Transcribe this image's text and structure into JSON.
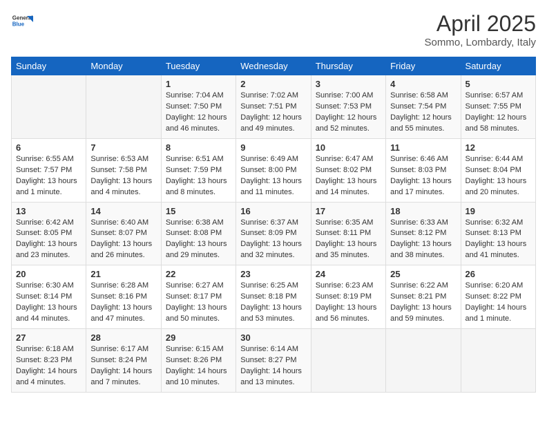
{
  "header": {
    "logo_general": "General",
    "logo_blue": "Blue",
    "month": "April 2025",
    "location": "Sommo, Lombardy, Italy"
  },
  "weekdays": [
    "Sunday",
    "Monday",
    "Tuesday",
    "Wednesday",
    "Thursday",
    "Friday",
    "Saturday"
  ],
  "weeks": [
    [
      null,
      null,
      {
        "day": "1",
        "info": "Sunrise: 7:04 AM\nSunset: 7:50 PM\nDaylight: 12 hours and 46 minutes."
      },
      {
        "day": "2",
        "info": "Sunrise: 7:02 AM\nSunset: 7:51 PM\nDaylight: 12 hours and 49 minutes."
      },
      {
        "day": "3",
        "info": "Sunrise: 7:00 AM\nSunset: 7:53 PM\nDaylight: 12 hours and 52 minutes."
      },
      {
        "day": "4",
        "info": "Sunrise: 6:58 AM\nSunset: 7:54 PM\nDaylight: 12 hours and 55 minutes."
      },
      {
        "day": "5",
        "info": "Sunrise: 6:57 AM\nSunset: 7:55 PM\nDaylight: 12 hours and 58 minutes."
      }
    ],
    [
      {
        "day": "6",
        "info": "Sunrise: 6:55 AM\nSunset: 7:57 PM\nDaylight: 13 hours and 1 minute."
      },
      {
        "day": "7",
        "info": "Sunrise: 6:53 AM\nSunset: 7:58 PM\nDaylight: 13 hours and 4 minutes."
      },
      {
        "day": "8",
        "info": "Sunrise: 6:51 AM\nSunset: 7:59 PM\nDaylight: 13 hours and 8 minutes."
      },
      {
        "day": "9",
        "info": "Sunrise: 6:49 AM\nSunset: 8:00 PM\nDaylight: 13 hours and 11 minutes."
      },
      {
        "day": "10",
        "info": "Sunrise: 6:47 AM\nSunset: 8:02 PM\nDaylight: 13 hours and 14 minutes."
      },
      {
        "day": "11",
        "info": "Sunrise: 6:46 AM\nSunset: 8:03 PM\nDaylight: 13 hours and 17 minutes."
      },
      {
        "day": "12",
        "info": "Sunrise: 6:44 AM\nSunset: 8:04 PM\nDaylight: 13 hours and 20 minutes."
      }
    ],
    [
      {
        "day": "13",
        "info": "Sunrise: 6:42 AM\nSunset: 8:05 PM\nDaylight: 13 hours and 23 minutes."
      },
      {
        "day": "14",
        "info": "Sunrise: 6:40 AM\nSunset: 8:07 PM\nDaylight: 13 hours and 26 minutes."
      },
      {
        "day": "15",
        "info": "Sunrise: 6:38 AM\nSunset: 8:08 PM\nDaylight: 13 hours and 29 minutes."
      },
      {
        "day": "16",
        "info": "Sunrise: 6:37 AM\nSunset: 8:09 PM\nDaylight: 13 hours and 32 minutes."
      },
      {
        "day": "17",
        "info": "Sunrise: 6:35 AM\nSunset: 8:11 PM\nDaylight: 13 hours and 35 minutes."
      },
      {
        "day": "18",
        "info": "Sunrise: 6:33 AM\nSunset: 8:12 PM\nDaylight: 13 hours and 38 minutes."
      },
      {
        "day": "19",
        "info": "Sunrise: 6:32 AM\nSunset: 8:13 PM\nDaylight: 13 hours and 41 minutes."
      }
    ],
    [
      {
        "day": "20",
        "info": "Sunrise: 6:30 AM\nSunset: 8:14 PM\nDaylight: 13 hours and 44 minutes."
      },
      {
        "day": "21",
        "info": "Sunrise: 6:28 AM\nSunset: 8:16 PM\nDaylight: 13 hours and 47 minutes."
      },
      {
        "day": "22",
        "info": "Sunrise: 6:27 AM\nSunset: 8:17 PM\nDaylight: 13 hours and 50 minutes."
      },
      {
        "day": "23",
        "info": "Sunrise: 6:25 AM\nSunset: 8:18 PM\nDaylight: 13 hours and 53 minutes."
      },
      {
        "day": "24",
        "info": "Sunrise: 6:23 AM\nSunset: 8:19 PM\nDaylight: 13 hours and 56 minutes."
      },
      {
        "day": "25",
        "info": "Sunrise: 6:22 AM\nSunset: 8:21 PM\nDaylight: 13 hours and 59 minutes."
      },
      {
        "day": "26",
        "info": "Sunrise: 6:20 AM\nSunset: 8:22 PM\nDaylight: 14 hours and 1 minute."
      }
    ],
    [
      {
        "day": "27",
        "info": "Sunrise: 6:18 AM\nSunset: 8:23 PM\nDaylight: 14 hours and 4 minutes."
      },
      {
        "day": "28",
        "info": "Sunrise: 6:17 AM\nSunset: 8:24 PM\nDaylight: 14 hours and 7 minutes."
      },
      {
        "day": "29",
        "info": "Sunrise: 6:15 AM\nSunset: 8:26 PM\nDaylight: 14 hours and 10 minutes."
      },
      {
        "day": "30",
        "info": "Sunrise: 6:14 AM\nSunset: 8:27 PM\nDaylight: 14 hours and 13 minutes."
      },
      null,
      null,
      null
    ]
  ]
}
